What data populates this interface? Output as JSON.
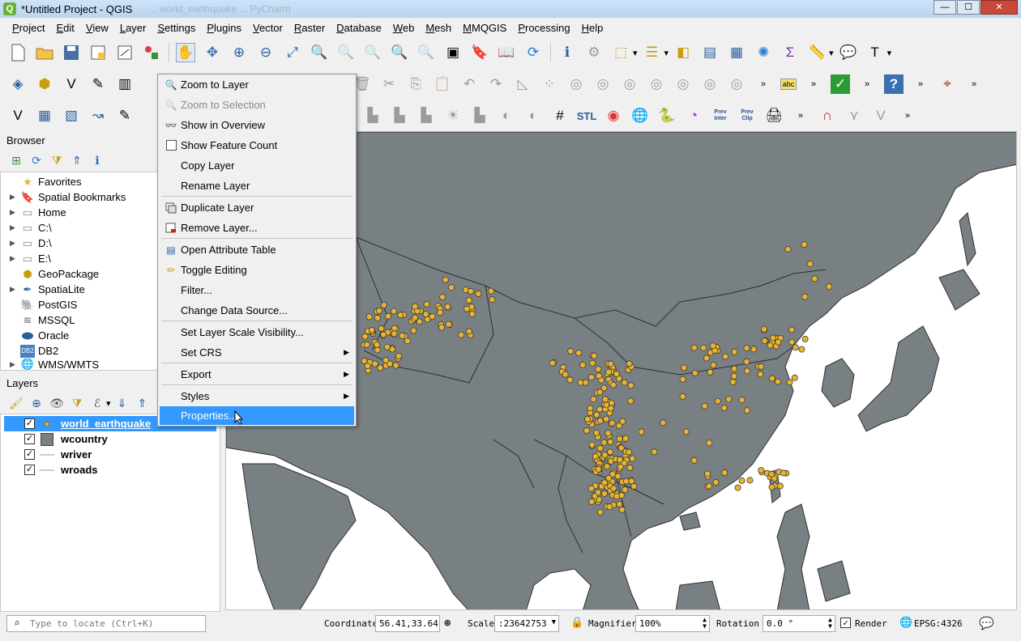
{
  "window": {
    "title": "*Untitled Project - QGIS",
    "background_tab_text": "... world_earthquake ... PyCharm"
  },
  "menubar": [
    "Project",
    "Edit",
    "View",
    "Layer",
    "Settings",
    "Plugins",
    "Vector",
    "Raster",
    "Database",
    "Web",
    "Mesh",
    "MMQGIS",
    "Processing",
    "Help"
  ],
  "browser": {
    "title": "Browser",
    "items": [
      {
        "label": "Favorites",
        "icon": "star-icon",
        "expand": false
      },
      {
        "label": "Spatial Bookmarks",
        "icon": "bookmark-icon",
        "expand": true
      },
      {
        "label": "Home",
        "icon": "folder-icon",
        "expand": true
      },
      {
        "label": "C:\\",
        "icon": "drive-icon",
        "expand": true
      },
      {
        "label": "D:\\",
        "icon": "drive-icon",
        "expand": true
      },
      {
        "label": "E:\\",
        "icon": "drive-icon",
        "expand": true
      },
      {
        "label": "GeoPackage",
        "icon": "geopackage-icon",
        "expand": false
      },
      {
        "label": "SpatiaLite",
        "icon": "spatialite-icon",
        "expand": true
      },
      {
        "label": "PostGIS",
        "icon": "postgis-icon",
        "expand": false
      },
      {
        "label": "MSSQL",
        "icon": "mssql-icon",
        "expand": false
      },
      {
        "label": "Oracle",
        "icon": "oracle-icon",
        "expand": false
      },
      {
        "label": "DB2",
        "icon": "db2-icon",
        "expand": false
      },
      {
        "label": "WMS/WMTS",
        "icon": "wms-icon",
        "expand": true
      }
    ]
  },
  "layers": {
    "title": "Layers",
    "items": [
      {
        "name": "world_earthquake",
        "checked": true,
        "selected": true,
        "symbol": "point"
      },
      {
        "name": "wcountry",
        "checked": true,
        "selected": false,
        "symbol": "polygon"
      },
      {
        "name": "wriver",
        "checked": true,
        "selected": false,
        "symbol": "line"
      },
      {
        "name": "wroads",
        "checked": true,
        "selected": false,
        "symbol": "line"
      }
    ]
  },
  "context_menu": {
    "items": [
      {
        "label": "Zoom to Layer",
        "icon": "zoom-layer-icon",
        "disabled": false
      },
      {
        "label": "Zoom to Selection",
        "icon": "zoom-selection-icon",
        "disabled": true
      },
      {
        "label": "Show in Overview",
        "icon": "overview-icon",
        "disabled": false
      },
      {
        "label": "Show Feature Count",
        "icon": "checkbox-icon",
        "disabled": false
      },
      {
        "label": "Copy Layer",
        "icon": "",
        "disabled": false
      },
      {
        "label": "Rename Layer",
        "icon": "",
        "disabled": false
      },
      {
        "label": "Duplicate Layer",
        "icon": "duplicate-icon",
        "disabled": false
      },
      {
        "label": "Remove Layer...",
        "icon": "remove-layer-icon",
        "disabled": false
      },
      {
        "label": "Open Attribute Table",
        "icon": "table-icon",
        "disabled": false
      },
      {
        "label": "Toggle Editing",
        "icon": "pencil-icon",
        "disabled": false
      },
      {
        "label": "Filter...",
        "icon": "",
        "disabled": false
      },
      {
        "label": "Change Data Source...",
        "icon": "",
        "disabled": false
      },
      {
        "label": "Set Layer Scale Visibility...",
        "icon": "",
        "disabled": false
      },
      {
        "label": "Set CRS",
        "icon": "",
        "disabled": false,
        "submenu": true
      },
      {
        "label": "Export",
        "icon": "",
        "disabled": false,
        "submenu": true
      },
      {
        "label": "Styles",
        "icon": "",
        "disabled": false,
        "submenu": true
      },
      {
        "label": "Properties...",
        "icon": "",
        "disabled": false,
        "highlighted": true
      }
    ]
  },
  "statusbar": {
    "locate_placeholder": "Type to locate (Ctrl+K)",
    "coordinate_label": "Coordinate",
    "coordinate_value": "56.41,33.64",
    "scale_label": "Scale",
    "scale_value": ":23642753",
    "magnifier_label": "Magnifier",
    "magnifier_value": "100%",
    "rotation_label": "Rotation",
    "rotation_value": "0.0 °",
    "render_label": "Render",
    "render_checked": true,
    "crs": "EPSG:4326"
  },
  "toolbar_labels": {
    "stl": "STL",
    "prev_inter": "Prev Inter",
    "prev_clip": "Prev Clip",
    "label_abc": "abc"
  },
  "colors": {
    "land": "#798084",
    "earthquake_point": "#e8b430",
    "highlight": "#3399ff"
  }
}
